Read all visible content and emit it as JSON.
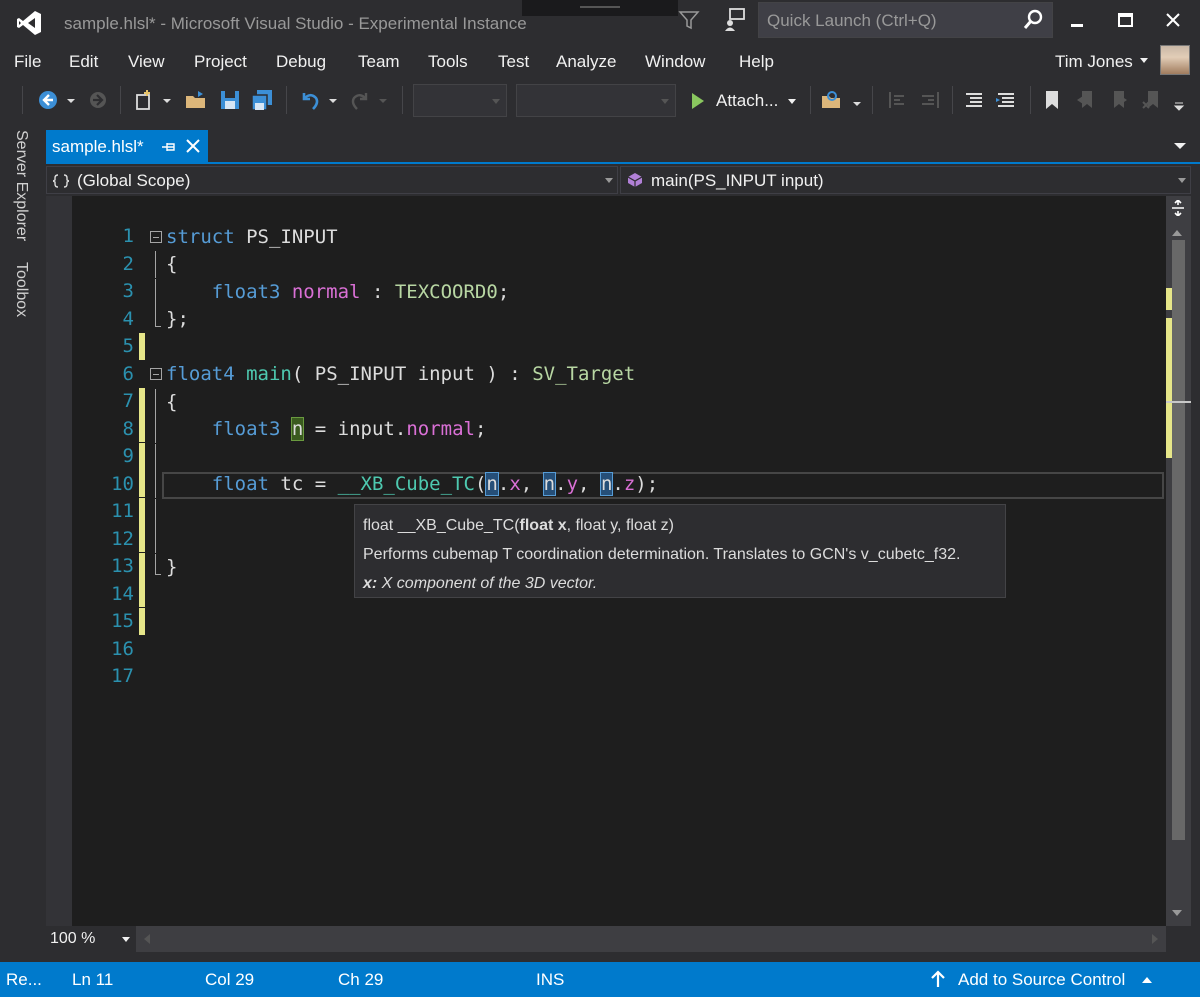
{
  "window": {
    "title": "sample.hlsl* - Microsoft Visual Studio - Experimental Instance",
    "quick_launch_placeholder": "Quick Launch (Ctrl+Q)"
  },
  "menu": {
    "items": [
      "File",
      "Edit",
      "View",
      "Project",
      "Debug",
      "Team",
      "Tools",
      "Test",
      "Analyze",
      "Window",
      "Help"
    ],
    "user_name": "Tim Jones"
  },
  "toolbar": {
    "attach_label": "Attach..."
  },
  "side_tabs": [
    "Server Explorer",
    "Toolbox"
  ],
  "document_tab": {
    "name": "sample.hlsl*"
  },
  "navigation": {
    "scope": "(Global Scope)",
    "member": "main(PS_INPUT input)"
  },
  "code": {
    "line_numbers": [
      "1",
      "2",
      "3",
      "4",
      "5",
      "6",
      "7",
      "8",
      "9",
      "10",
      "11",
      "12",
      "13",
      "14",
      "15",
      "16",
      "17"
    ]
  },
  "tooltip": {
    "signature_pre": "float __XB_Cube_TC(",
    "signature_bold": "float x",
    "signature_post": ", float y, float z)",
    "description": "Performs cubemap T coordination determination. Translates to GCN's v_cubetc_f32.",
    "param_name": "x:",
    "param_desc": " X component of the 3D vector."
  },
  "editor": {
    "zoom": "100 %"
  },
  "status": {
    "ready": "Re...",
    "line": "Ln 11",
    "col": "Col 29",
    "ch": "Ch 29",
    "mode": "INS",
    "source_control": "Add to Source Control"
  },
  "colors": {
    "accent": "#007acc",
    "background": "#2d2d30",
    "editor_bg": "#1e1e1e",
    "line_number": "#2b91af",
    "change_marker": "#e6e689"
  }
}
